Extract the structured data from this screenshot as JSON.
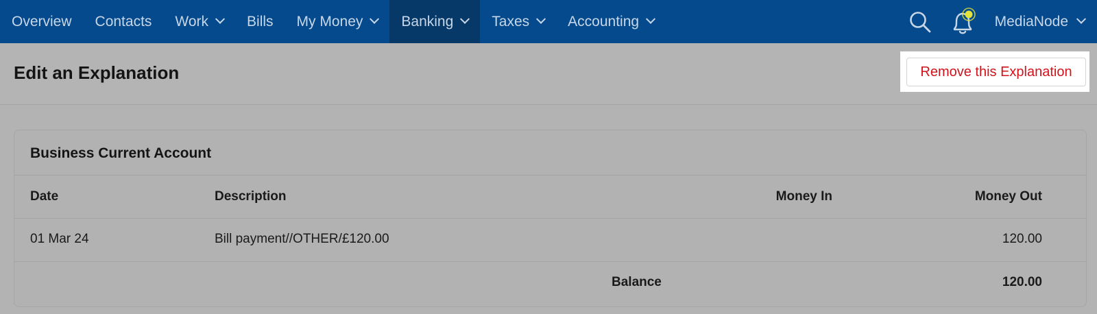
{
  "nav": {
    "items": [
      {
        "label": "Overview",
        "has_menu": false,
        "active": false
      },
      {
        "label": "Contacts",
        "has_menu": false,
        "active": false
      },
      {
        "label": "Work",
        "has_menu": true,
        "active": false
      },
      {
        "label": "Bills",
        "has_menu": false,
        "active": false
      },
      {
        "label": "My Money",
        "has_menu": true,
        "active": false
      },
      {
        "label": "Banking",
        "has_menu": true,
        "active": true
      },
      {
        "label": "Taxes",
        "has_menu": true,
        "active": false
      },
      {
        "label": "Accounting",
        "has_menu": true,
        "active": false
      }
    ],
    "search_icon": "search-icon",
    "notifications_icon": "bell-icon",
    "account_label": "MediaNode"
  },
  "header": {
    "title": "Edit an Explanation",
    "remove_label": "Remove this Explanation"
  },
  "card": {
    "title": "Business Current Account",
    "columns": {
      "date": "Date",
      "description": "Description",
      "money_in": "Money In",
      "money_out": "Money Out"
    },
    "row": {
      "date": "01 Mar 24",
      "description": "Bill payment//OTHER/£120.00",
      "money_in": "",
      "money_out": "120.00"
    },
    "balance_label": "Balance",
    "balance_value": "120.00"
  },
  "colors": {
    "nav_bg": "#044a8c",
    "nav_active_bg": "#063968",
    "remove_text": "#d0131a",
    "notification_dot": "#e2e23a"
  }
}
